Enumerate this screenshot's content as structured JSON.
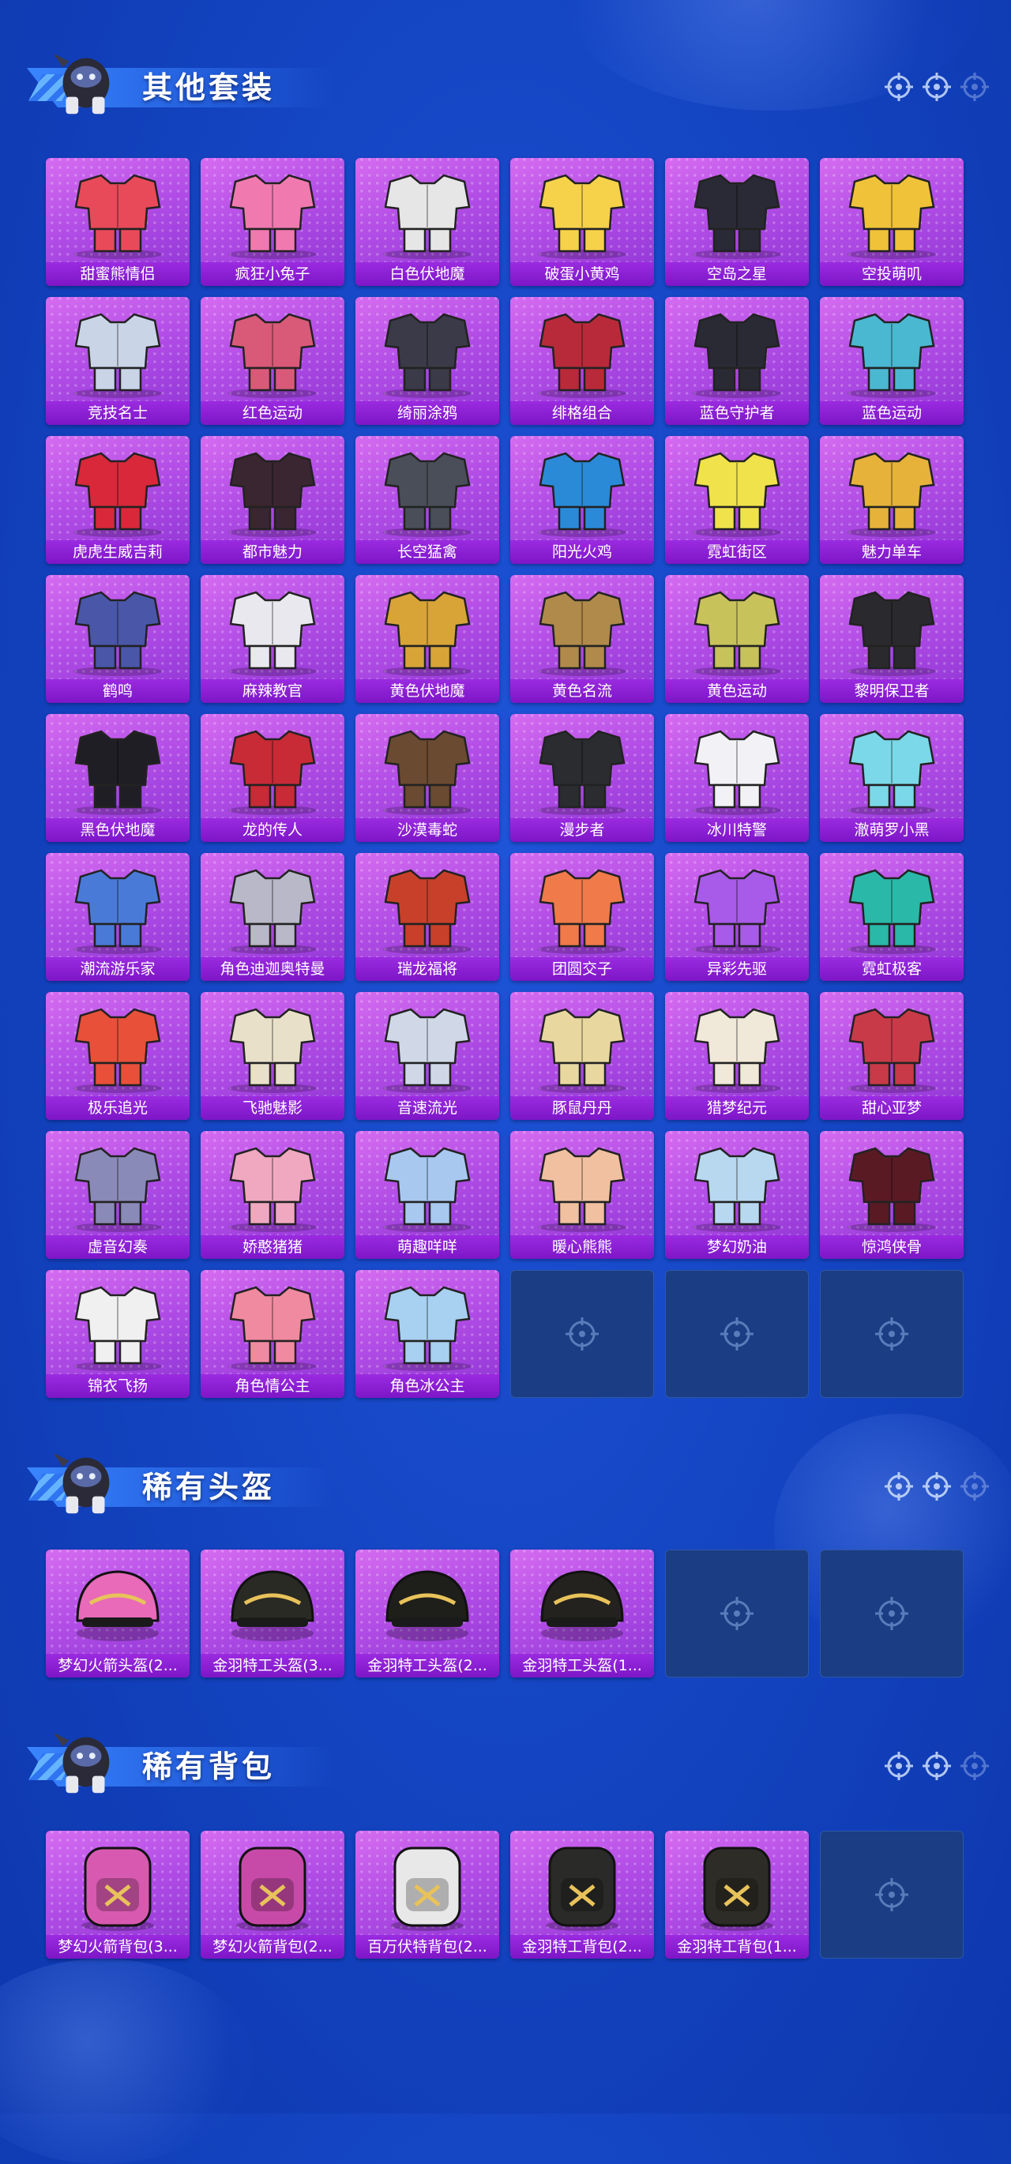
{
  "colors": {
    "background": "#1546c4",
    "card": "#b24de6",
    "card_label": "#7d16c7",
    "empty_card": "#1a3d84",
    "title": "#ffffff"
  },
  "sections": [
    {
      "title": "其他套装",
      "items": [
        {
          "label": "甜蜜熊情侣",
          "icon": "outfit-icon",
          "accent": "#e84a5a"
        },
        {
          "label": "疯狂小兔子",
          "icon": "outfit-icon",
          "accent": "#f07ab0"
        },
        {
          "label": "白色伏地魔",
          "icon": "outfit-icon",
          "accent": "#e6e6e6"
        },
        {
          "label": "破蛋小黄鸡",
          "icon": "outfit-icon",
          "accent": "#f6d24a"
        },
        {
          "label": "空岛之星",
          "icon": "outfit-icon",
          "accent": "#2a2a36"
        },
        {
          "label": "空投萌叽",
          "icon": "outfit-icon",
          "accent": "#f0c23a"
        },
        {
          "label": "竞技名士",
          "icon": "outfit-icon",
          "accent": "#c9d4e6"
        },
        {
          "label": "红色运动",
          "icon": "outfit-icon",
          "accent": "#d85a78"
        },
        {
          "label": "绮丽涂鸦",
          "icon": "outfit-icon",
          "accent": "#3a3a48"
        },
        {
          "label": "绯格组合",
          "icon": "outfit-icon",
          "accent": "#b82a3a"
        },
        {
          "label": "蓝色守护者",
          "icon": "outfit-icon",
          "accent": "#2a2a34"
        },
        {
          "label": "蓝色运动",
          "icon": "outfit-icon",
          "accent": "#4ab8d0"
        },
        {
          "label": "虎虎生威吉莉",
          "icon": "outfit-icon",
          "accent": "#d8283a"
        },
        {
          "label": "都市魅力",
          "icon": "outfit-icon",
          "accent": "#3a2630"
        },
        {
          "label": "长空猛禽",
          "icon": "outfit-icon",
          "accent": "#4a4e58"
        },
        {
          "label": "阳光火鸡",
          "icon": "outfit-icon",
          "accent": "#2a8ad8"
        },
        {
          "label": "霓虹街区",
          "icon": "outfit-icon",
          "accent": "#f0e24a"
        },
        {
          "label": "魅力单车",
          "icon": "outfit-icon",
          "accent": "#e6b23a"
        },
        {
          "label": "鹤鸣",
          "icon": "outfit-icon",
          "accent": "#4a56a8"
        },
        {
          "label": "麻辣教官",
          "icon": "outfit-icon",
          "accent": "#e8e8ee"
        },
        {
          "label": "黄色伏地魔",
          "icon": "outfit-icon",
          "accent": "#d8a438"
        },
        {
          "label": "黄色名流",
          "icon": "outfit-icon",
          "accent": "#b08a4a"
        },
        {
          "label": "黄色运动",
          "icon": "outfit-icon",
          "accent": "#c8c25a"
        },
        {
          "label": "黎明保卫者",
          "icon": "outfit-icon",
          "accent": "#2a2a2e"
        },
        {
          "label": "黑色伏地魔",
          "icon": "outfit-icon",
          "accent": "#1e1e24"
        },
        {
          "label": "龙的传人",
          "icon": "outfit-icon",
          "accent": "#c82a36"
        },
        {
          "label": "沙漠毒蛇",
          "icon": "outfit-icon",
          "accent": "#6a4a30"
        },
        {
          "label": "漫步者",
          "icon": "outfit-icon",
          "accent": "#2a2c30"
        },
        {
          "label": "冰川特警",
          "icon": "outfit-icon",
          "accent": "#f2f2f6"
        },
        {
          "label": "澈萌罗小黑",
          "icon": "outfit-icon",
          "accent": "#7ad8e8"
        },
        {
          "label": "潮流游乐家",
          "icon": "outfit-icon",
          "accent": "#4a7ad8"
        },
        {
          "label": "角色迪迦奥特曼",
          "icon": "outfit-icon",
          "accent": "#b8b8c8"
        },
        {
          "label": "瑞龙福将",
          "icon": "outfit-icon",
          "accent": "#c8402a"
        },
        {
          "label": "团圆交子",
          "icon": "outfit-icon",
          "accent": "#f07a4a"
        },
        {
          "label": "异彩先驱",
          "icon": "outfit-icon",
          "accent": "#a85ae8"
        },
        {
          "label": "霓虹极客",
          "icon": "outfit-icon",
          "accent": "#2ab8a8"
        },
        {
          "label": "极乐追光",
          "icon": "outfit-icon",
          "accent": "#e8503a"
        },
        {
          "label": "飞驰魅影",
          "icon": "outfit-icon",
          "accent": "#e8e0c8"
        },
        {
          "label": "音速流光",
          "icon": "outfit-icon",
          "accent": "#d0d8e8"
        },
        {
          "label": "豚鼠丹丹",
          "icon": "outfit-icon",
          "accent": "#e8d8a0"
        },
        {
          "label": "猎梦纪元",
          "icon": "outfit-icon",
          "accent": "#f0e8d8"
        },
        {
          "label": "甜心亚梦",
          "icon": "outfit-icon",
          "accent": "#c83a48"
        },
        {
          "label": "虚音幻奏",
          "icon": "outfit-icon",
          "accent": "#8a8ab8"
        },
        {
          "label": "娇憨猪猪",
          "icon": "outfit-icon",
          "accent": "#f0a8c0"
        },
        {
          "label": "萌趣咩咩",
          "icon": "outfit-icon",
          "accent": "#a8c8f0"
        },
        {
          "label": "暖心熊熊",
          "icon": "outfit-icon",
          "accent": "#f0c0a0"
        },
        {
          "label": "梦幻奶油",
          "icon": "outfit-icon",
          "accent": "#b8d8f0"
        },
        {
          "label": "惊鸿侠骨",
          "icon": "outfit-icon",
          "accent": "#5a1a24"
        },
        {
          "label": "锦衣飞扬",
          "icon": "outfit-icon",
          "accent": "#f0f0f0"
        },
        {
          "label": "角色情公主",
          "icon": "outfit-icon",
          "accent": "#f08aa0"
        },
        {
          "label": "角色冰公主",
          "icon": "outfit-icon",
          "accent": "#a8d0f0"
        },
        {
          "label": "",
          "icon": "crosshair-icon",
          "empty": true
        },
        {
          "label": "",
          "icon": "crosshair-icon",
          "empty": true
        },
        {
          "label": "",
          "icon": "crosshair-icon",
          "empty": true
        }
      ]
    },
    {
      "title": "稀有头盔",
      "items": [
        {
          "label": "梦幻火箭头盔(2...",
          "icon": "helmet-icon",
          "accent": "#e86ab8"
        },
        {
          "label": "金羽特工头盔(3...",
          "icon": "helmet-icon",
          "accent": "#2a2a24"
        },
        {
          "label": "金羽特工头盔(2...",
          "icon": "helmet-icon",
          "accent": "#1e1e1a"
        },
        {
          "label": "金羽特工头盔(1...",
          "icon": "helmet-icon",
          "accent": "#24221e"
        },
        {
          "label": "",
          "icon": "crosshair-icon",
          "empty": true
        },
        {
          "label": "",
          "icon": "crosshair-icon",
          "empty": true
        }
      ]
    },
    {
      "title": "稀有背包",
      "items": [
        {
          "label": "梦幻火箭背包(3...",
          "icon": "backpack-icon",
          "accent": "#d85ab0"
        },
        {
          "label": "梦幻火箭背包(2...",
          "icon": "backpack-icon",
          "accent": "#c84aa8"
        },
        {
          "label": "百万伏特背包(2...",
          "icon": "backpack-icon",
          "accent": "#e8e8e8"
        },
        {
          "label": "金羽特工背包(2...",
          "icon": "backpack-icon",
          "accent": "#2a2a28"
        },
        {
          "label": "金羽特工背包(1...",
          "icon": "backpack-icon",
          "accent": "#2e2c26"
        },
        {
          "label": "",
          "icon": "crosshair-icon",
          "empty": true
        }
      ]
    }
  ]
}
